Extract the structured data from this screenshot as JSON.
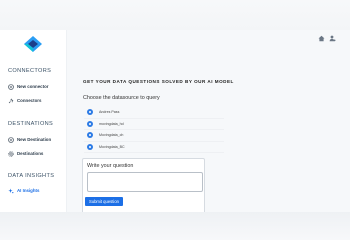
{
  "sidebar": {
    "sections": [
      {
        "title": "CONNECTORS",
        "items": [
          {
            "label": "New connector",
            "icon": "plus-circle-icon"
          },
          {
            "label": "Connectors",
            "icon": "plug-icon"
          }
        ]
      },
      {
        "title": "DESTINATIONS",
        "items": [
          {
            "label": "New Destination",
            "icon": "plus-circle-icon"
          },
          {
            "label": "Destinations",
            "icon": "gear-icon"
          }
        ]
      },
      {
        "title": "DATA INSIGHTS",
        "items": [
          {
            "label": "AI Insights",
            "icon": "sparkle-icon"
          }
        ]
      }
    ]
  },
  "main": {
    "heading": "GET YOUR DATA QUESTIONS SOLVED BY OUR AI MODEL",
    "datasource_label": "Choose the datasource to query",
    "datasources": [
      "Andres Pass",
      "movingdata_hd",
      "Movingdata_ch",
      "Movingdata_BC"
    ],
    "question_label": "Write your question",
    "question_value": "",
    "submit_label": "Submit question"
  },
  "colors": {
    "accent": "#1c6fe6",
    "logo_a": "#2a9df4",
    "logo_b": "#1b3f8b"
  }
}
